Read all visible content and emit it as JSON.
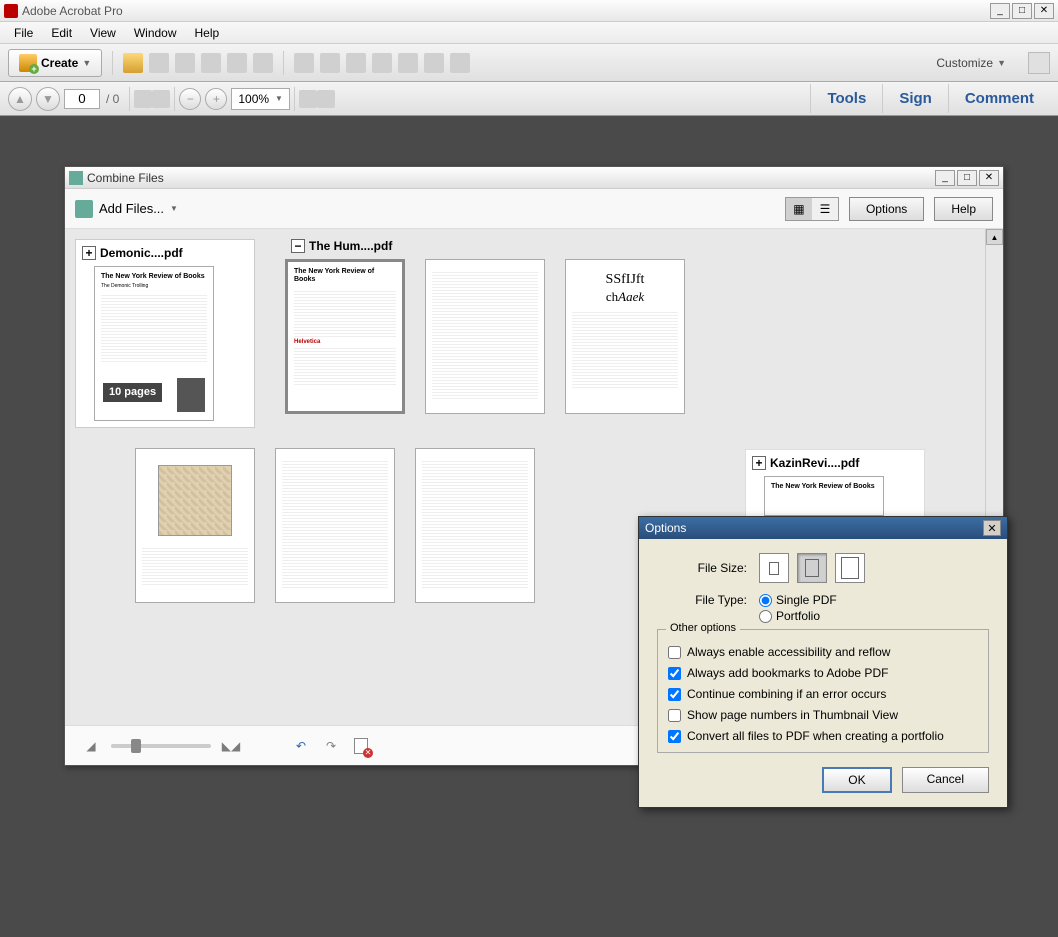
{
  "app": {
    "title": "Adobe Acrobat Pro"
  },
  "menu": {
    "file": "File",
    "edit": "Edit",
    "view": "View",
    "window": "Window",
    "help": "Help"
  },
  "toolbar": {
    "create": "Create",
    "customize": "Customize"
  },
  "nav": {
    "page_current": "0",
    "page_total": "/ 0",
    "zoom": "100%"
  },
  "tabs": {
    "tools": "Tools",
    "sign": "Sign",
    "comment": "Comment"
  },
  "combine": {
    "title": "Combine Files",
    "add_files": "Add Files...",
    "options": "Options",
    "help": "Help",
    "files": [
      {
        "name": "Demonic....pdf",
        "pages": "10 pages",
        "expanded": false
      },
      {
        "name": "The Hum....pdf",
        "expanded": true
      },
      {
        "name": "KazinRevi....pdf",
        "expanded": false
      }
    ],
    "thumb_heading": "The New York Review of Books"
  },
  "options_dialog": {
    "title": "Options",
    "file_size": "File Size:",
    "file_type": "File Type:",
    "type_single": "Single PDF",
    "type_portfolio": "Portfolio",
    "other_options": "Other options",
    "opts": [
      {
        "label": "Always enable accessibility and reflow",
        "checked": false
      },
      {
        "label": "Always add bookmarks to Adobe PDF",
        "checked": true
      },
      {
        "label": "Continue combining if an error occurs",
        "checked": true
      },
      {
        "label": "Show page numbers in Thumbnail View",
        "checked": false
      },
      {
        "label": "Convert all files to PDF when creating a portfolio",
        "checked": true
      }
    ],
    "ok": "OK",
    "cancel": "Cancel"
  }
}
